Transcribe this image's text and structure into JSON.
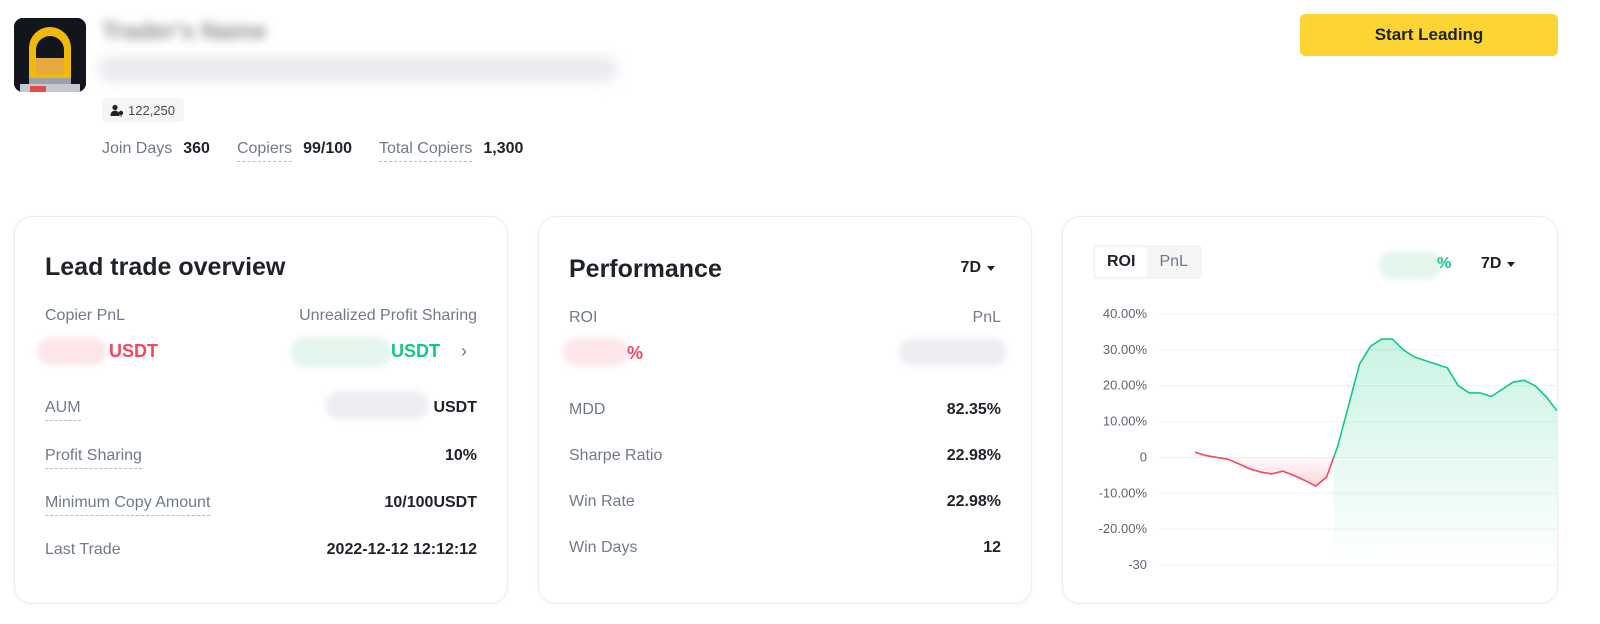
{
  "header": {
    "trader_name": "Trader's Name",
    "followers": "122,250",
    "stats": [
      {
        "label": "Join Days",
        "value": "360"
      },
      {
        "label": "Copiers",
        "value": "99/100"
      },
      {
        "label": "Total Copiers",
        "value": "1,300"
      }
    ],
    "start_button": "Start Leading"
  },
  "overview": {
    "title": "Lead trade overview",
    "copier_pnl_label": "Copier PnL",
    "copier_pnl_unit": "USDT",
    "unrealized_label": "Unrealized Profit Sharing",
    "unrealized_unit": "USDT",
    "unrealized_arrow": "›",
    "rows": [
      {
        "label": "AUM",
        "value": "USDT"
      },
      {
        "label": "Profit Sharing",
        "value": "10%"
      },
      {
        "label": "Minimum Copy Amount",
        "value": "10/100USDT"
      },
      {
        "label": "Last Trade",
        "value": "2022-12-12 12:12:12"
      }
    ]
  },
  "performance": {
    "title": "Performance",
    "period": "7D",
    "roi_label": "ROI",
    "pnl_label": "PnL",
    "roi_suffix": "%",
    "rows": [
      {
        "label": "MDD",
        "value": "82.35%"
      },
      {
        "label": "Sharpe Ratio",
        "value": "22.98%"
      },
      {
        "label": "Win Rate",
        "value": "22.98%"
      },
      {
        "label": "Win Days",
        "value": "12"
      }
    ]
  },
  "chart_panel": {
    "tabs": [
      "ROI",
      "PnL"
    ],
    "active_tab": "ROI",
    "value_suffix": "%",
    "period": "7D"
  },
  "chart_data": {
    "type": "line",
    "y_ticks": [
      "40.00%",
      "30.00%",
      "20.00%",
      "10.00%",
      "0",
      "-10.00%",
      "-20.00%",
      "-30"
    ],
    "ylim": [
      -30,
      40
    ],
    "grid": true,
    "colors": {
      "positive": "#0ecb81",
      "negative": "#f6465d"
    },
    "series": [
      {
        "x": [
          0,
          1,
          2,
          3,
          4,
          5,
          6,
          7,
          8,
          9,
          10,
          11,
          12,
          13,
          14,
          15,
          16,
          17,
          18,
          19,
          20,
          21,
          22,
          23,
          24,
          25,
          26,
          27,
          28,
          29,
          30,
          31,
          32,
          33
        ],
        "values": [
          1.5,
          0.5,
          0.0,
          -0.5,
          -1.8,
          -3.2,
          -4.1,
          -4.6,
          -3.8,
          -5.0,
          -6.4,
          -8.0,
          -5.5,
          3.0,
          14.5,
          26.0,
          31.0,
          33.0,
          33.0,
          30.0,
          28.0,
          27.0,
          26.0,
          25.0,
          20.0,
          18.0,
          18.0,
          17.0,
          19.0,
          21.0,
          21.5,
          20.0,
          17.0,
          13.0
        ]
      }
    ]
  }
}
